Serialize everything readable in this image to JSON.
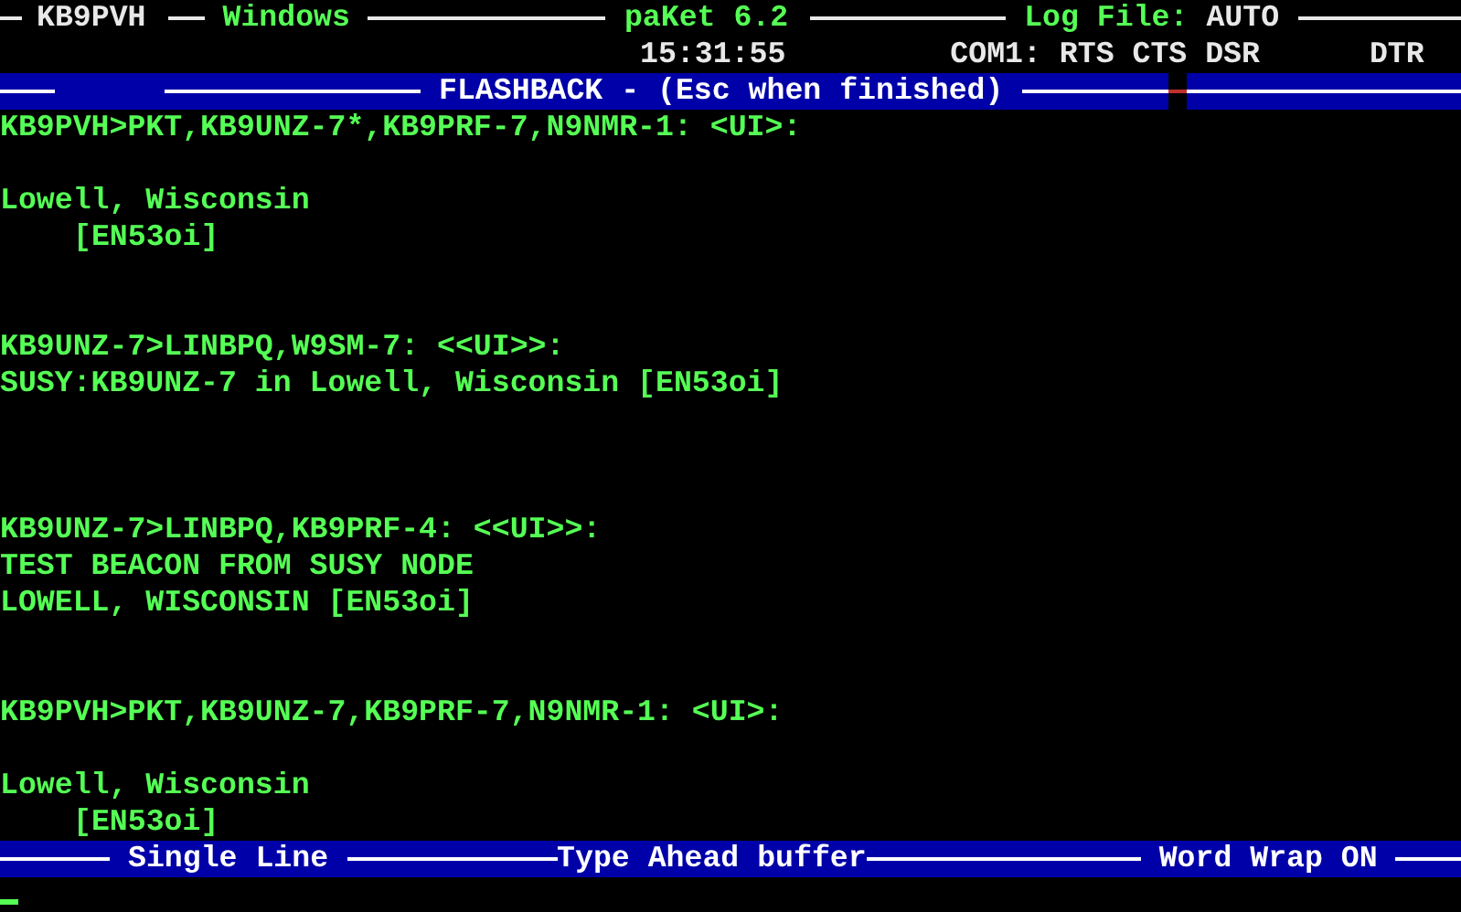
{
  "status_line": {
    "callsign": "KB9PVH",
    "mode": "Windows",
    "program": "paKet 6.2",
    "log_label": "Log File:",
    "log_value": "AUTO",
    "time": "15:31:55",
    "port_status": "COM1: RTS CTS DSR",
    "extra_signal": "DTR"
  },
  "flashback_bar": {
    "title": "FLASHBACK - (Esc when finished)"
  },
  "lines": [
    {
      "kind": "line",
      "text": "KB9PVH>PKT,KB9UNZ-7*,KB9PRF-7,N9NMR-1: <UI>:"
    },
    {
      "kind": "blank"
    },
    {
      "kind": "line",
      "text": "Lowell, Wisconsin"
    },
    {
      "kind": "indented",
      "text": "[EN53oi]"
    },
    {
      "kind": "blank"
    },
    {
      "kind": "blank"
    },
    {
      "kind": "line",
      "text": "KB9UNZ-7>LINBPQ,W9SM-7: <<UI>>:"
    },
    {
      "kind": "line",
      "text": "SUSY:KB9UNZ-7 in Lowell, Wisconsin [EN53oi]"
    },
    {
      "kind": "blank"
    },
    {
      "kind": "blank"
    },
    {
      "kind": "blank"
    },
    {
      "kind": "line",
      "text": "KB9UNZ-7>LINBPQ,KB9PRF-4: <<UI>>:"
    },
    {
      "kind": "line",
      "text": "TEST BEACON FROM SUSY NODE"
    },
    {
      "kind": "line",
      "text": "LOWELL, WISCONSIN [EN53oi]"
    },
    {
      "kind": "blank"
    },
    {
      "kind": "blank"
    },
    {
      "kind": "line",
      "text": "KB9PVH>PKT,KB9UNZ-7,KB9PRF-7,N9NMR-1: <UI>:"
    },
    {
      "kind": "blank"
    },
    {
      "kind": "line",
      "text": "Lowell, Wisconsin"
    },
    {
      "kind": "indented",
      "text": "[EN53oi]"
    }
  ],
  "bottom_bar": {
    "items": [
      "Single Line",
      "Type Ahead buffer",
      "Word Wrap ON"
    ]
  }
}
